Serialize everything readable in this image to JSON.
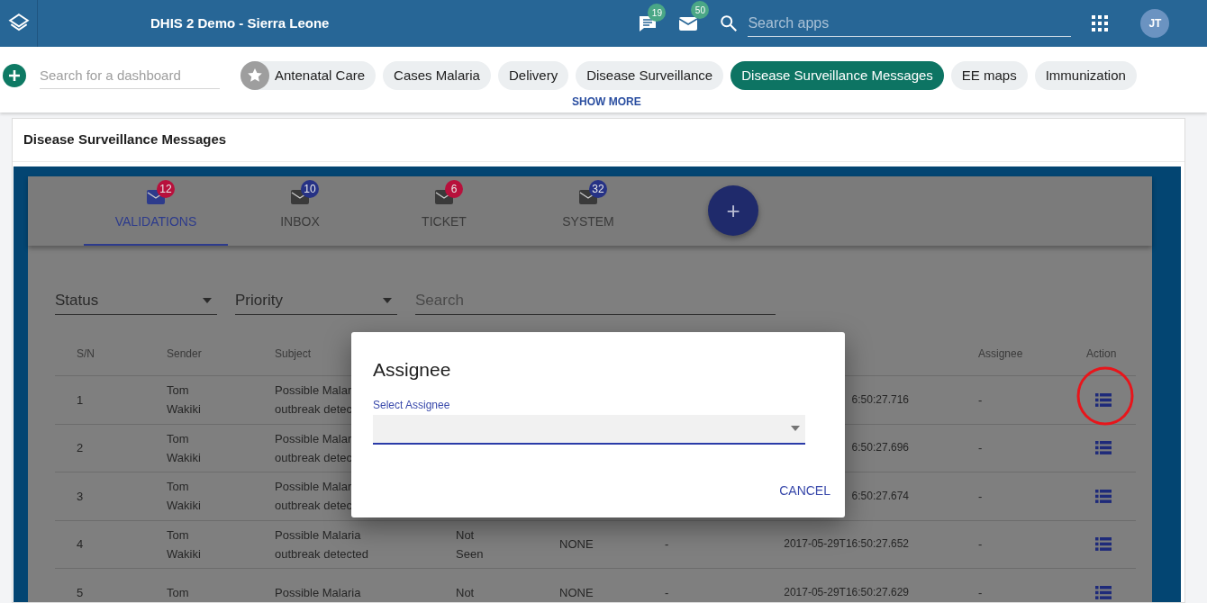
{
  "header": {
    "title": "DHIS 2 Demo - Sierra Leone",
    "messages_count": "19",
    "mail_count": "50",
    "search": {
      "placeholder": "Search apps"
    },
    "avatar": "JT"
  },
  "dashboard_bar": {
    "search": {
      "placeholder": "Search for a dashboard"
    },
    "chips": [
      {
        "label": "Antenatal Care",
        "starred": true,
        "selected": false
      },
      {
        "label": "Cases Malaria",
        "starred": false,
        "selected": false
      },
      {
        "label": "Delivery",
        "starred": false,
        "selected": false
      },
      {
        "label": "Disease Surveillance",
        "starred": false,
        "selected": false
      },
      {
        "label": "Disease Surveillance Messages",
        "starred": false,
        "selected": true
      },
      {
        "label": "EE maps",
        "starred": false,
        "selected": false
      },
      {
        "label": "Immunization",
        "starred": false,
        "selected": false
      }
    ],
    "show_more": "SHOW MORE"
  },
  "card": {
    "title": "Disease Surveillance Messages"
  },
  "tabs": [
    {
      "label": "VALIDATIONS",
      "count": "12",
      "color": "#b8103c",
      "selected": true
    },
    {
      "label": "INBOX",
      "count": "10",
      "color": "#263285",
      "selected": false
    },
    {
      "label": "TICKET",
      "count": "6",
      "color": "#b8103c",
      "selected": false
    },
    {
      "label": "SYSTEM",
      "count": "32",
      "color": "#263285",
      "selected": false
    }
  ],
  "fab": "+",
  "filters": [
    {
      "kind": "select",
      "placeholder": "Status"
    },
    {
      "kind": "select",
      "placeholder": "Priority"
    },
    {
      "kind": "text",
      "placeholder": "Search"
    }
  ],
  "table": {
    "columns": {
      "sn": "S/N",
      "sender": "Sender",
      "subject": "Subject",
      "assignee": "Assignee",
      "action": "Action"
    },
    "rows": [
      {
        "sn": "1",
        "sender": "Tom Wakiki",
        "subject": "Possible Malar outbreak detec",
        "date": "6:50:27.716",
        "assignee": "-"
      },
      {
        "sn": "2",
        "sender": "Tom Wakiki",
        "subject": "Possible Malar outbreak detec",
        "date": "6:50:27.696",
        "assignee": "-"
      },
      {
        "sn": "3",
        "sender": "Tom Wakiki",
        "subject": "Possible Malar outbreak detec",
        "date": "6:50:27.674",
        "assignee": "-"
      },
      {
        "sn": "4",
        "sender": "Tom Wakiki",
        "subject": "Possible Malaria outbreak detected",
        "status": "Not Seen",
        "priority": "NONE",
        "column_6": "-",
        "date": "2017-05-29T16:50:27.652",
        "assignee": "-"
      },
      {
        "sn": "5",
        "sender": "Tom",
        "subject": "Possible Malaria",
        "status": "Not",
        "priority": "NONE",
        "column_6": "-",
        "date": "2017-05-29T16:50:27.629",
        "assignee": "-"
      }
    ]
  },
  "dialog": {
    "title": "Assignee",
    "field": {
      "label": "Select Assignee"
    },
    "cancel": "CANCEL"
  }
}
